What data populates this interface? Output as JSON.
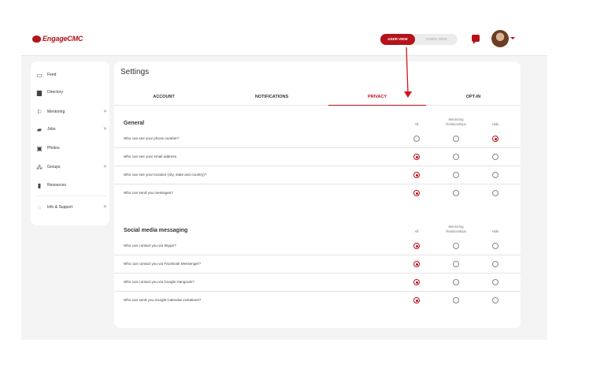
{
  "brand": {
    "logo_text": "EngageCMC",
    "color": "#b5121b"
  },
  "header": {
    "user_view_label": "USER VIEW",
    "admin_view_label": "ADMIN VIEW"
  },
  "sidebar": {
    "items": [
      {
        "label": "Feed",
        "icon": "feed-icon",
        "chevron": ""
      },
      {
        "label": "Directory",
        "icon": "directory-icon",
        "chevron": ""
      },
      {
        "label": "Mentoring",
        "icon": "mentoring-icon",
        "chevron": ">"
      },
      {
        "label": "Jobs",
        "icon": "briefcase-icon",
        "chevron": ">"
      },
      {
        "label": "Photos",
        "icon": "image-icon",
        "chevron": ""
      },
      {
        "label": "Groups",
        "icon": "groups-icon",
        "chevron": ">"
      },
      {
        "label": "Resources",
        "icon": "document-icon",
        "chevron": ""
      },
      {
        "label": "Info & Support",
        "icon": "support-icon",
        "chevron": ">"
      }
    ]
  },
  "page": {
    "title": "Settings"
  },
  "tabs": [
    "ACCOUNT",
    "NOTIFICATIONS",
    "PRIVACY",
    "OPT-IN"
  ],
  "active_tab": "PRIVACY",
  "columns": {
    "all": "All",
    "mentoring": "Mentoring\nRelationships",
    "hide": "Hide"
  },
  "sections": [
    {
      "title": "General",
      "rows": [
        {
          "label": "Who can see your phone number?",
          "selected": "hide"
        },
        {
          "label": "Who can see your email address",
          "selected": "all"
        },
        {
          "label": "Who can see your location (city, state and country)?",
          "selected": "all"
        },
        {
          "label": "Who can send you messages?",
          "selected": "all"
        }
      ]
    },
    {
      "title": "Social media messaging",
      "rows": [
        {
          "label": "Who can contact you via Skype?",
          "selected": "all"
        },
        {
          "label": "Who can contact you via Facebook Messenger?",
          "selected": "all"
        },
        {
          "label": "Who can contact you via Google Hangouts?",
          "selected": "all"
        },
        {
          "label": "Who can send you Google Calendar invitations?",
          "selected": "all"
        }
      ]
    }
  ]
}
